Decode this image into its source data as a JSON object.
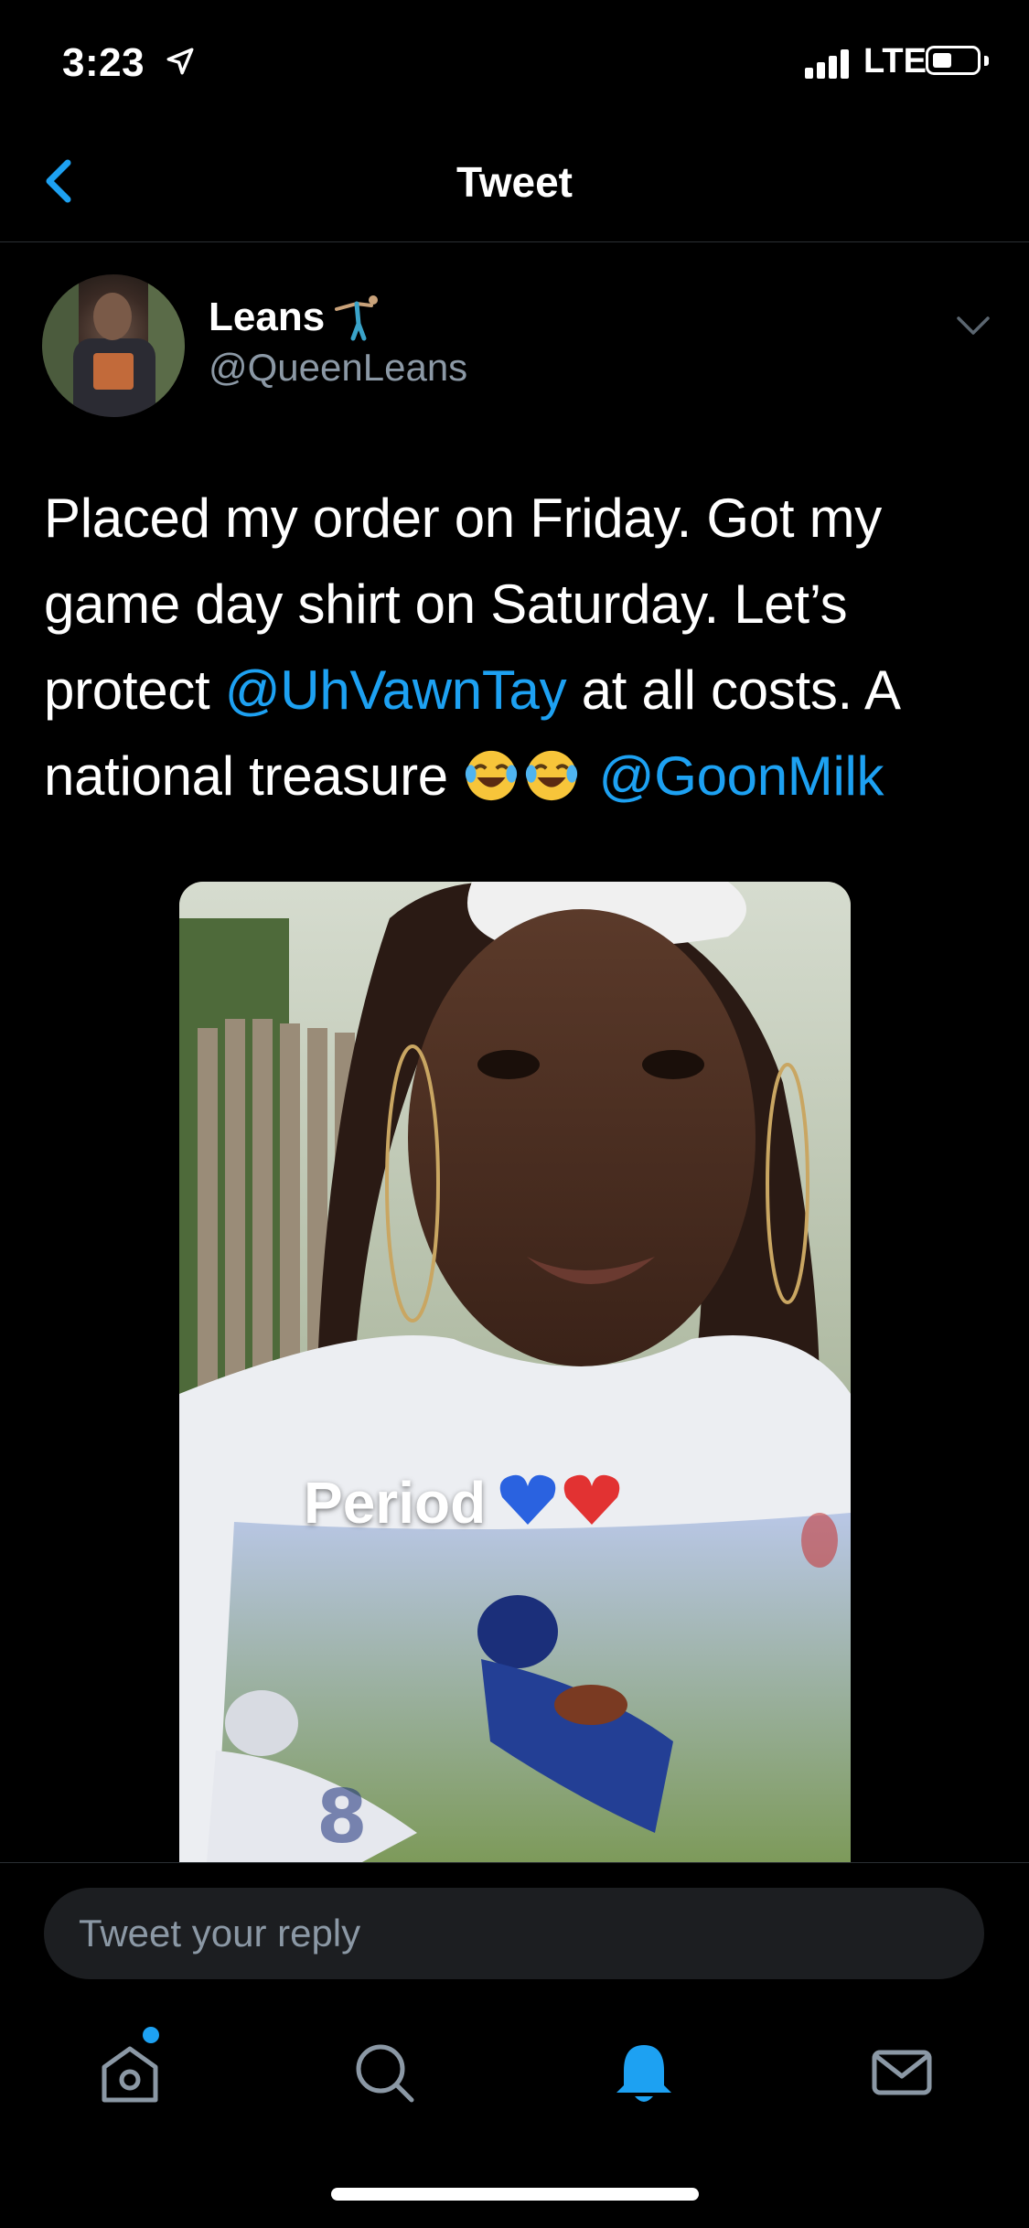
{
  "status_bar": {
    "time": "3:23",
    "carrier": "LTE"
  },
  "nav": {
    "title": "Tweet"
  },
  "tweet": {
    "display_name": "Leans",
    "handle": "@QueenLeans",
    "text_parts": {
      "p1": "Placed my order on Friday. Got my game day shirt on Saturday. Let’s protect ",
      "mention1": "@UhVawnTay",
      "p2": " at all costs. A national treasure ",
      "mention2": "@GoonMilk"
    },
    "image_caption": "Period"
  },
  "reply": {
    "placeholder": "Tweet your reply"
  },
  "tabs": [
    "home",
    "search",
    "notifications",
    "messages"
  ],
  "colors": {
    "accent": "#1da1f2",
    "muted": "#8b98a5",
    "background": "#000000"
  }
}
